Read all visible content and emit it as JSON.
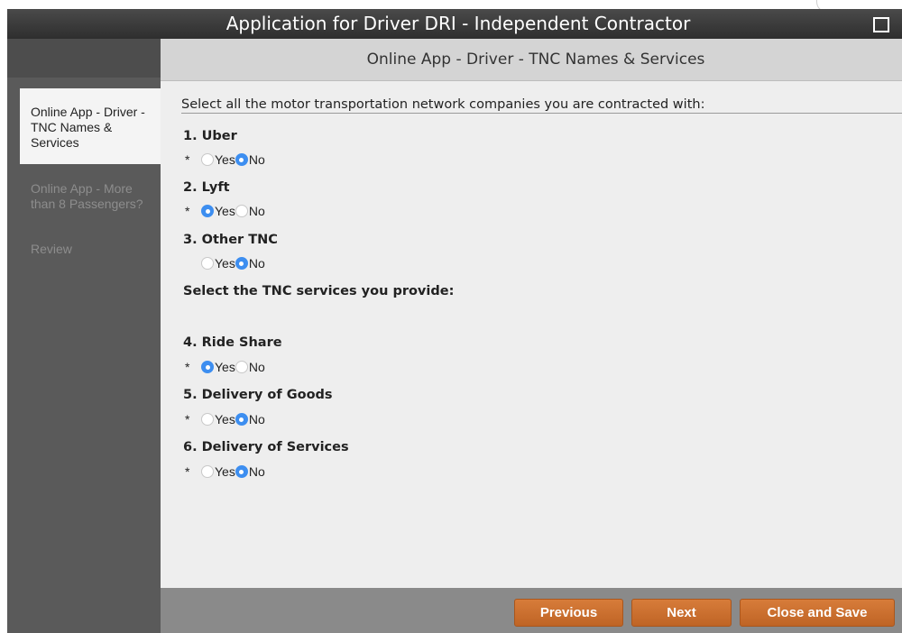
{
  "window": {
    "title": "Application for Driver DRI - Independent Contractor",
    "maximize_icon": "maximize-square-icon"
  },
  "sidebar": {
    "items": [
      {
        "label": "Online App - Driver - TNC Names & Services",
        "active": true
      },
      {
        "label": "Online App - More than 8 Passengers?",
        "active": false
      },
      {
        "label": "Review",
        "active": false
      }
    ]
  },
  "header": {
    "title": "Online App - Driver - TNC Names & Services"
  },
  "form": {
    "intro": "Select all the motor transportation network companies you are contracted with:",
    "section2_heading": "Select the TNC services you provide:",
    "yes_label": "Yes",
    "no_label": "No",
    "required_marker": "*",
    "questions": [
      {
        "label": "1. Uber",
        "required": true,
        "selected": "No"
      },
      {
        "label": "2. Lyft",
        "required": true,
        "selected": "Yes"
      },
      {
        "label": "3. Other TNC",
        "required": false,
        "selected": "No"
      },
      {
        "label": "4. Ride Share",
        "required": true,
        "selected": "Yes"
      },
      {
        "label": "5. Delivery of Goods",
        "required": true,
        "selected": "No"
      },
      {
        "label": "6. Delivery of Services",
        "required": true,
        "selected": "No"
      }
    ]
  },
  "footer": {
    "previous_label": "Previous",
    "next_label": "Next",
    "close_save_label": "Close and Save"
  },
  "colors": {
    "accent_button": "#cc6f2e",
    "radio_selected": "#3d8ef0",
    "titlebar": "#3a3a3a"
  }
}
